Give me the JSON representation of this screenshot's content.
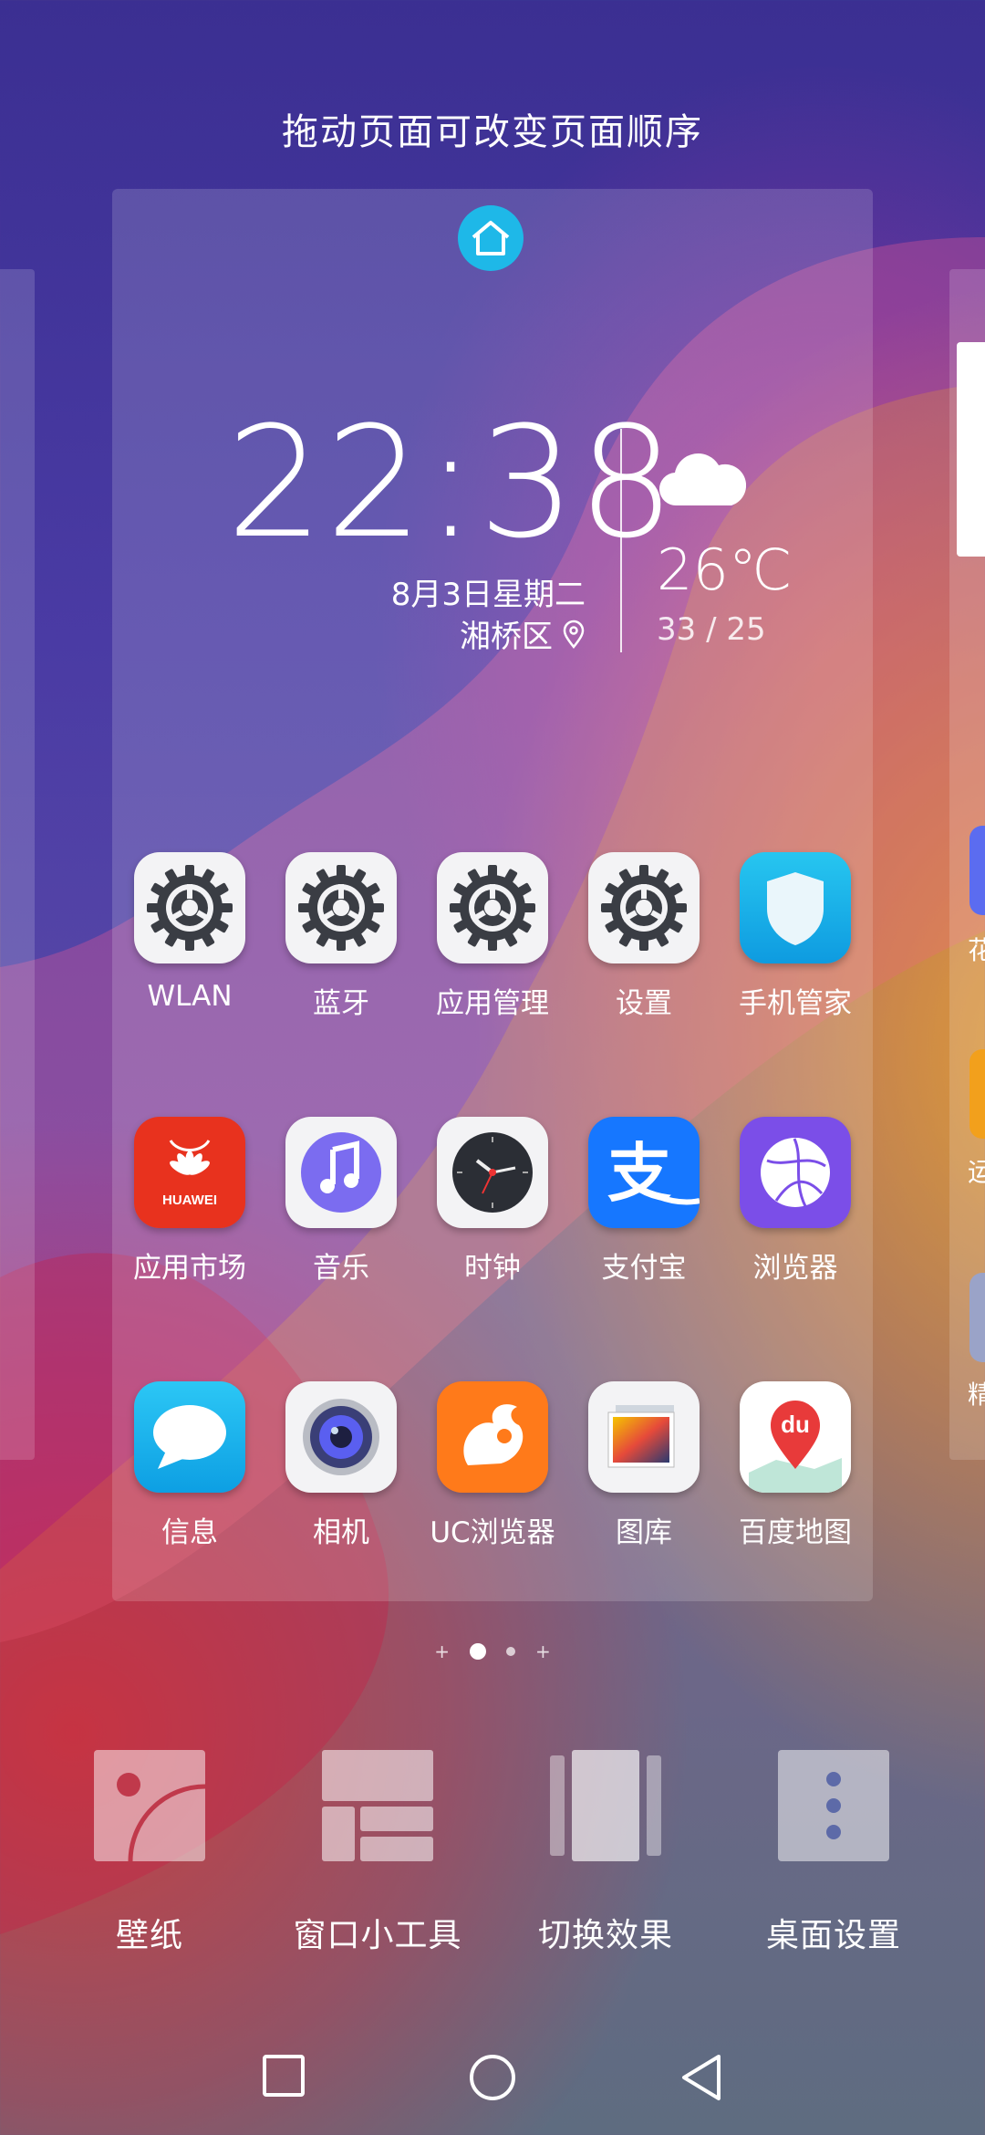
{
  "hint": "拖动页面可改变页面顺序",
  "clock": {
    "time": "22:38",
    "date": "8月3日星期二",
    "location": "湘桥区",
    "temperature": "26℃",
    "temp_range": "33 / 25"
  },
  "apps": [
    {
      "label": "WLAN",
      "icon": "settings-icon"
    },
    {
      "label": "蓝牙",
      "icon": "settings-icon"
    },
    {
      "label": "应用管理",
      "icon": "settings-icon"
    },
    {
      "label": "设置",
      "icon": "settings-icon"
    },
    {
      "label": "手机管家",
      "icon": "shield-icon"
    },
    {
      "label": "应用市场",
      "icon": "huawei-appgallery-icon",
      "icon_text": "HUAWEI"
    },
    {
      "label": "音乐",
      "icon": "music-note-icon"
    },
    {
      "label": "时钟",
      "icon": "clock-icon"
    },
    {
      "label": "支付宝",
      "icon": "alipay-icon",
      "icon_text": "支"
    },
    {
      "label": "浏览器",
      "icon": "browser-globe-icon"
    },
    {
      "label": "信息",
      "icon": "message-bubble-icon"
    },
    {
      "label": "相机",
      "icon": "camera-lens-icon"
    },
    {
      "label": "UC浏览器",
      "icon": "uc-squirrel-icon"
    },
    {
      "label": "图库",
      "icon": "gallery-photo-icon"
    },
    {
      "label": "百度地图",
      "icon": "baidu-map-pin-icon",
      "icon_text": "du"
    }
  ],
  "peek_right": {
    "labels": [
      "花",
      "运",
      "精"
    ]
  },
  "page_indicator": {
    "count": 2,
    "active": 1
  },
  "tools": [
    {
      "label": "壁纸",
      "icon": "wallpaper-icon"
    },
    {
      "label": "窗口小工具",
      "icon": "widgets-icon"
    },
    {
      "label": "切换效果",
      "icon": "transition-effect-icon"
    },
    {
      "label": "桌面设置",
      "icon": "more-vertical-icon"
    }
  ],
  "navbar": [
    "recent-apps-icon",
    "home-circle-icon",
    "back-triangle-icon"
  ],
  "colors": {
    "home_badge": "#1eb8e8",
    "huawei_red": "#e8321e",
    "alipay_blue": "#1677ff",
    "uc_orange": "#ff7a1a",
    "browser_purple": "#7b4ee8"
  }
}
